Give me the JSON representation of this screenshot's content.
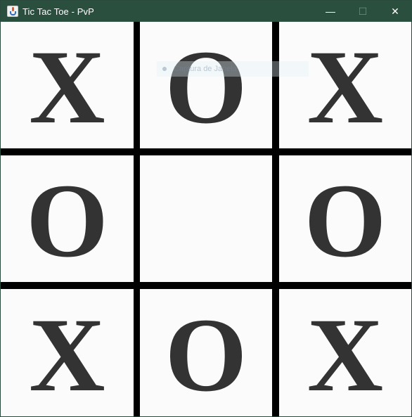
{
  "window": {
    "title": "Tic Tac Toe - PvP",
    "icon": "java-cup-icon",
    "controls": {
      "minimize": "—",
      "maximize": "☐",
      "close": "✕"
    }
  },
  "board": {
    "cells": [
      "X",
      "O",
      "X",
      "O",
      "",
      "O",
      "X",
      "O",
      "X"
    ]
  },
  "overlay": {
    "text": "Captura de Janela"
  },
  "colors": {
    "titlebar": "#2b4f3f",
    "mark": "#333333",
    "grid_lines": "#000000",
    "cell_background": "#fbfbfb"
  }
}
